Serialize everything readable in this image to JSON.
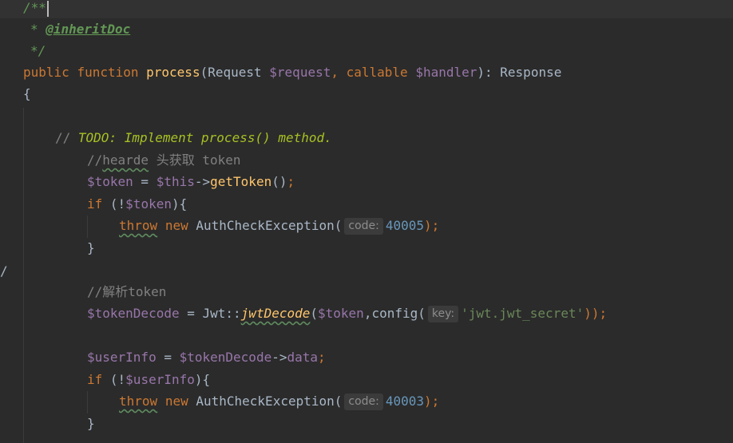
{
  "editor": {
    "doc_open": "/**",
    "doc_star": "* ",
    "doc_tag": "@inheritDoc",
    "doc_close": "*/",
    "sig": {
      "kw_public": "public",
      "kw_function": "function",
      "fn_name": "process",
      "open": "(",
      "type_request": "Request ",
      "var_request": "$request",
      "comma": ", ",
      "kw_callable": "callable",
      "var_handler": "$handler",
      "close": "): ",
      "return_type": "Response"
    },
    "brace_open": "{",
    "todo_prefix": "// ",
    "todo_text": "TODO: Implement process() method.",
    "comment1_slashes": "//",
    "comment1_word": "hearde",
    "comment1_rest": " 头获取 token",
    "token_line": {
      "var": "$token",
      "eq": " = ",
      "this": "$this",
      "arrow": "->",
      "call": "getToken",
      "parens": "()",
      "semi": ";"
    },
    "if1": {
      "kw": "if",
      "open": " (!",
      "var": "$token",
      "close": "){"
    },
    "throw1": {
      "kw_throw": "throw",
      "kw_new": "new",
      "cls": "AuthCheckException(",
      "hint": "code:",
      "num": "40005",
      "close": ");"
    },
    "brace_close_1": "}",
    "left_margin_mark": "/",
    "comment2": "//解析token",
    "decode_line": {
      "var": "$tokenDecode",
      "eq": " = ",
      "cls": "Jwt::",
      "call": "jwtDecode",
      "open": "(",
      "arg": "$token",
      "config": ",config(",
      "hint": "key:",
      "str": "'jwt.jwt_secret'",
      "close": "));"
    },
    "userinfo_line": {
      "var": "$userInfo",
      "eq": " = ",
      "src": "$tokenDecode",
      "arrow": "->",
      "prop": "data",
      "semi": ";"
    },
    "if2": {
      "kw": "if",
      "open": " (!",
      "var": "$userInfo",
      "close": "){"
    },
    "throw2": {
      "kw_throw": "throw",
      "kw_new": "new",
      "cls": "AuthCheckException(",
      "hint": "code:",
      "num": "40003",
      "close": ");"
    },
    "brace_close_2": "}"
  }
}
